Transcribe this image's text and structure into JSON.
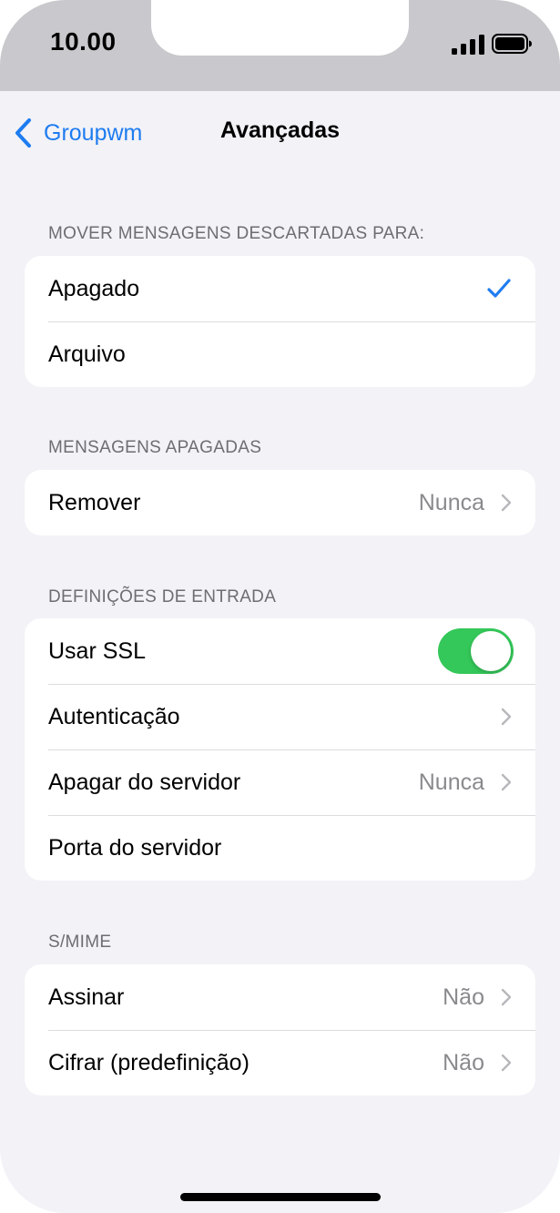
{
  "status_bar": {
    "time": "10.00"
  },
  "nav": {
    "back_label": "Groupwm",
    "title": "Avançadas"
  },
  "sections": {
    "move_discarded": {
      "header": "MOVER MENSAGENS DESCARTADAS PARA:",
      "options": [
        {
          "label": "Apagado",
          "selected": true
        },
        {
          "label": "Arquivo",
          "selected": false
        }
      ]
    },
    "deleted_messages": {
      "header": "MENSAGENS APAGADAS",
      "remove": {
        "label": "Remover",
        "value": "Nunca"
      }
    },
    "incoming_settings": {
      "header": "DEFINIÇÕES DE ENTRADA",
      "use_ssl": {
        "label": "Usar SSL",
        "on": true
      },
      "authentication": {
        "label": "Autenticação"
      },
      "delete_from_server": {
        "label": "Apagar do servidor",
        "value": "Nunca"
      },
      "server_port": {
        "label": "Porta do servidor"
      }
    },
    "smime": {
      "header": "S/MIME",
      "sign": {
        "label": "Assinar",
        "value": "Não"
      },
      "encrypt": {
        "label": "Cifrar (predefinição)",
        "value": "Não"
      }
    }
  },
  "colors": {
    "accent": "#1e7cf0",
    "toggle_on": "#34c759",
    "background": "#f2f2f7",
    "status_bar": "#c9c9cd"
  }
}
